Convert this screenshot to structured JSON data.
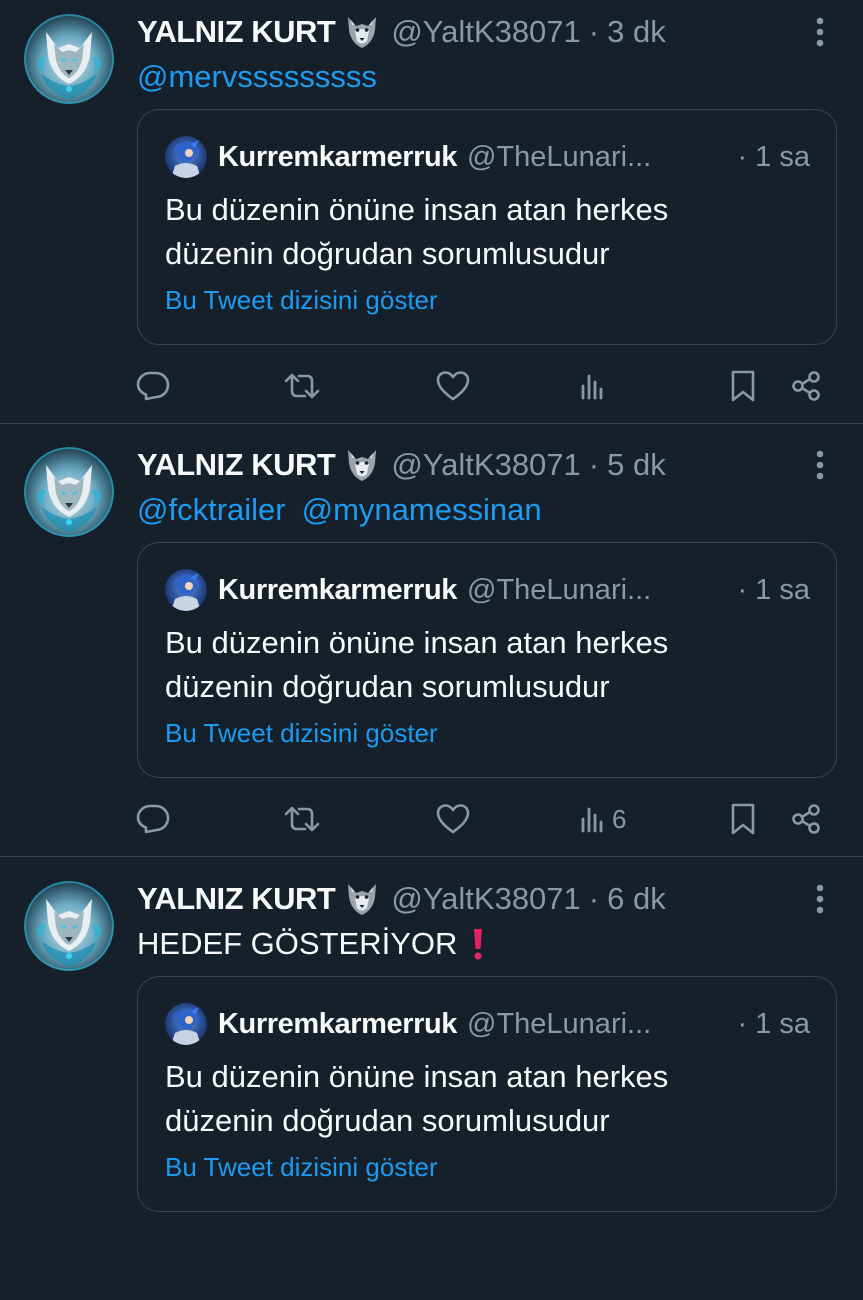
{
  "tweets": [
    {
      "author_name": "YALNIZ KURT",
      "author_emoji": "wolf-emoji",
      "handle": "@YaltK38071",
      "time": "3 dk",
      "mentions": [
        "@mervsssssssss"
      ],
      "text": "",
      "quote": {
        "author_name": "Kurremkarmerruk",
        "handle": "@TheLunari...",
        "time": "· 1 sa",
        "text_line1": "Bu düzenin önüne insan atan herkes",
        "text_line2": "düzenin doğrudan sorumlusudur",
        "show_thread": "Bu Tweet dizisini göster"
      },
      "views_count": ""
    },
    {
      "author_name": "YALNIZ KURT",
      "author_emoji": "wolf-emoji",
      "handle": "@YaltK38071",
      "time": "5 dk",
      "mentions": [
        "@fcktrailer",
        "@mynamessinan"
      ],
      "text": "",
      "quote": {
        "author_name": "Kurremkarmerruk",
        "handle": "@TheLunari...",
        "time": "· 1 sa",
        "text_line1": "Bu düzenin önüne insan atan herkes",
        "text_line2": "düzenin doğrudan sorumlusudur",
        "show_thread": "Bu Tweet dizisini göster"
      },
      "views_count": "6"
    },
    {
      "author_name": "YALNIZ KURT",
      "author_emoji": "wolf-emoji",
      "handle": "@YaltK38071",
      "time": "6 dk",
      "mentions": [],
      "text": "HEDEF GÖSTERİYOR",
      "text_emoji": "red-exclamation-icon",
      "quote": {
        "author_name": "Kurremkarmerruk",
        "handle": "@TheLunari...",
        "time": "· 1 sa",
        "text_line1": "Bu düzenin önüne insan atan herkes",
        "text_line2": "düzenin doğrudan sorumlusudur",
        "show_thread": "Bu Tweet dizisini göster"
      },
      "views_count": ""
    }
  ],
  "separator": "·",
  "colors": {
    "background": "#15202b",
    "text_primary": "#f7f9f9",
    "text_secondary": "#8b98a5",
    "accent": "#1d9bf0",
    "border": "#38444d",
    "exclamation": "#e0245e"
  }
}
